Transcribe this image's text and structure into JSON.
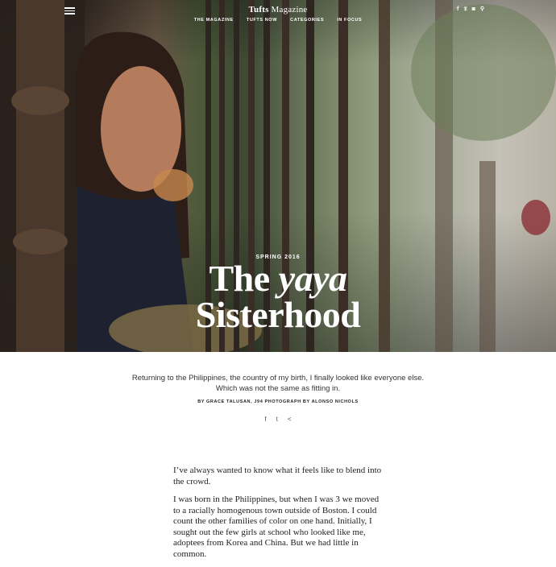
{
  "header": {
    "brand_bold": "Tufts",
    "brand_rest": " Magazine",
    "nav": [
      "THE MAGAZINE",
      "TUFTS NOW",
      "CATEGORIES",
      "IN FOCUS"
    ],
    "social": {
      "facebook": "f",
      "twitter": "𝕿",
      "instagram": "◙",
      "search": "⚲"
    }
  },
  "hero": {
    "season": "SPRING 2016",
    "title_line1_a": "The ",
    "title_line1_b": "yaya",
    "title_line2": "Sisterhood"
  },
  "article": {
    "dek": "Returning to the Philippines, the country of my birth, I finally looked like everyone else. Which was not the same as fitting in.",
    "byline": "BY GRACE TALUSAN, J94   PHOTOGRAPH BY ALONSO NICHOLS",
    "share": {
      "facebook": "f",
      "twitter": "t",
      "share": "<"
    },
    "paragraphs": [
      "I’ve always wanted to know what it feels like to blend into the crowd.",
      "I was born in the Philippines, but when I was 3 we moved to a racially homogenous town outside of Boston. I could count the other families of color on one hand. Initially, I sought out the few girls at school who looked like me, adoptees from Korea and China. But we had little in common."
    ]
  }
}
